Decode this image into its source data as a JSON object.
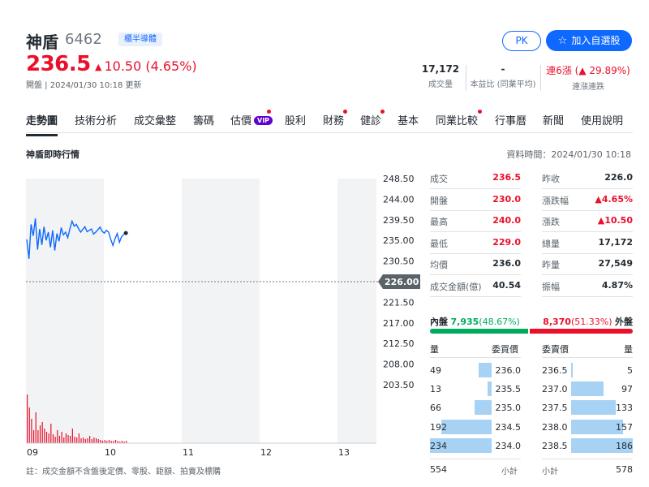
{
  "header": {
    "name": "神盾",
    "code": "6462",
    "tag": "櫃半導體",
    "price": "236.5",
    "change": "10.50 (4.65%)",
    "update": "開盤 | 2024/01/30 10:18 更新",
    "pk_label": "PK",
    "watch_label": "加入自選股",
    "stats": {
      "volume": {
        "value": "17,172",
        "label": "成交量"
      },
      "pe": {
        "value": "-",
        "label": "本益比 (同業平均)"
      },
      "streak": {
        "value": "連6漲 (▲ 29.89%)",
        "label": "連漲連跌"
      }
    }
  },
  "tabs": [
    "走勢圖",
    "技術分析",
    "成交彙整",
    "籌碼",
    "估價",
    "股利",
    "財務",
    "健診",
    "基本",
    "同業比較",
    "行事曆",
    "新聞",
    "使用說明"
  ],
  "vip_label": "VIP",
  "section": {
    "title": "神盾即時行情",
    "data_time": "資料時間：2024/01/30 10:18"
  },
  "chart_data": {
    "type": "line",
    "y_ticks": [
      "248.50",
      "244.00",
      "239.50",
      "235.00",
      "230.50",
      "226.00",
      "221.50",
      "217.00",
      "212.50",
      "208.00",
      "203.50"
    ],
    "ylim": [
      203.5,
      248.5
    ],
    "reference_price": "226.00",
    "reference_value": 226.0,
    "x_ticks": [
      "09",
      "10",
      "11",
      "12",
      "13"
    ],
    "price_series": [
      235.2,
      231.0,
      238.5,
      236.0,
      239.8,
      233.0,
      237.5,
      234.0,
      238.0,
      235.0,
      236.8,
      233.5,
      237.2,
      232.8,
      236.5,
      234.8,
      237.8,
      236.2,
      236.8,
      235.6,
      237.5,
      239.2,
      238.1,
      238.5,
      237.6,
      236.8,
      237.4,
      238.0,
      236.9,
      237.2,
      237.5,
      236.4,
      236.8,
      237.3,
      237.9,
      237.0,
      236.6,
      237.2,
      236.8,
      235.2,
      233.9,
      235.4,
      236.5,
      234.6,
      235.8,
      236.3,
      236.6
    ],
    "volume_series": [
      60,
      44,
      30,
      16,
      38,
      16,
      22,
      26,
      18,
      14,
      12,
      24,
      11,
      8,
      16,
      9,
      14,
      7,
      12,
      10,
      9,
      18,
      8,
      7,
      12,
      6,
      7,
      5,
      6,
      9,
      5,
      7,
      6,
      5,
      4,
      3,
      4,
      3,
      4,
      3,
      3,
      4,
      3,
      2,
      3,
      2,
      3
    ]
  },
  "note": "註：成交金額不含盤後定價、零股、鉅額、拍賣及標購",
  "quote": {
    "left": [
      {
        "label": "成交",
        "value": "236.5",
        "color": "red"
      },
      {
        "label": "開盤",
        "value": "230.0",
        "color": "red"
      },
      {
        "label": "最高",
        "value": "240.0",
        "color": "red"
      },
      {
        "label": "最低",
        "value": "229.0",
        "color": "red"
      },
      {
        "label": "均價",
        "value": "236.0",
        "color": "black"
      },
      {
        "label": "成交金額(億)",
        "value": "40.54",
        "color": "black"
      }
    ],
    "right": [
      {
        "label": "昨收",
        "value": "226.0",
        "color": "black"
      },
      {
        "label": "漲跌幅",
        "value": "▲4.65%",
        "color": "red"
      },
      {
        "label": "漲跌",
        "value": "▲10.50",
        "color": "red"
      },
      {
        "label": "總量",
        "value": "17,172",
        "color": "black"
      },
      {
        "label": "昨量",
        "value": "27,549",
        "color": "black"
      },
      {
        "label": "振幅",
        "value": "4.87%",
        "color": "black"
      }
    ]
  },
  "bidask": {
    "inner_label": "內盤",
    "inner_value": "7,935",
    "inner_pct": "(48.67%)",
    "inner_fraction": 0.4867,
    "outer_value": "8,370",
    "outer_pct": "(51.33%)",
    "outer_label": "外盤",
    "headers": {
      "bid_qty": "量",
      "bid_price": "委買價",
      "ask_price": "委賣價",
      "ask_qty": "量"
    },
    "bids": [
      {
        "qty": "49",
        "price": "236.0",
        "level": 0.21
      },
      {
        "qty": "13",
        "price": "235.5",
        "level": 0.06
      },
      {
        "qty": "66",
        "price": "235.0",
        "level": 0.28
      },
      {
        "qty": "192",
        "price": "234.5",
        "level": 0.82
      },
      {
        "qty": "234",
        "price": "234.0",
        "level": 1.0
      }
    ],
    "asks": [
      {
        "price": "236.5",
        "qty": "5",
        "level": 0.03
      },
      {
        "price": "237.0",
        "qty": "97",
        "level": 0.52
      },
      {
        "price": "237.5",
        "qty": "133",
        "level": 0.72
      },
      {
        "price": "238.0",
        "qty": "157",
        "level": 0.84
      },
      {
        "price": "238.5",
        "qty": "186",
        "level": 1.0
      }
    ],
    "bid_total": "554",
    "subtotal_label": "小計",
    "ask_total": "578"
  }
}
